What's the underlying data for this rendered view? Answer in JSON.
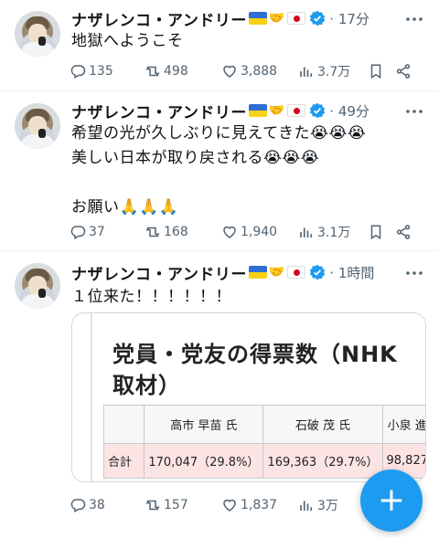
{
  "colors": {
    "accent": "#1d9bf0",
    "meta": "#536471",
    "total_row": "#fde4e4"
  },
  "tweets": [
    {
      "author": "ナザレンコ・アンドリー",
      "time": "17分",
      "text": "地獄へようこそ",
      "replies": "135",
      "retweets": "498",
      "likes": "3,888",
      "views": "3.7万"
    },
    {
      "author": "ナザレンコ・アンドリー",
      "time": "49分",
      "text": "希望の光が久しぶりに見えてきた😭😭😭\n美しい日本が取り戻される😭😭😭\n\nお願い🙏🙏🙏",
      "replies": "37",
      "retweets": "168",
      "likes": "1,940",
      "views": "3.1万"
    },
    {
      "author": "ナザレンコ・アンドリー",
      "time": "1時間",
      "text": "１位来た！！！！！！",
      "replies": "38",
      "retweets": "157",
      "likes": "1,837",
      "views": "3万",
      "card": {
        "title": "党員・党友の得票数（NHK取材）",
        "columns": [
          "",
          "高市 早苗 氏",
          "石破 茂 氏",
          "小泉 進"
        ],
        "total_row": [
          "合計",
          "170,047（29.8%）",
          "169,363（29.7%）",
          "98,827"
        ]
      }
    }
  ],
  "icons": {
    "verified": "verified-badge-icon",
    "more": "more-dots-icon",
    "reply": "reply-icon",
    "retweet": "retweet-icon",
    "like": "heart-icon",
    "views": "views-chart-icon",
    "bookmark": "bookmark-icon",
    "share": "share-icon",
    "compose": "plus-icon"
  },
  "fab": {
    "label": "+"
  }
}
